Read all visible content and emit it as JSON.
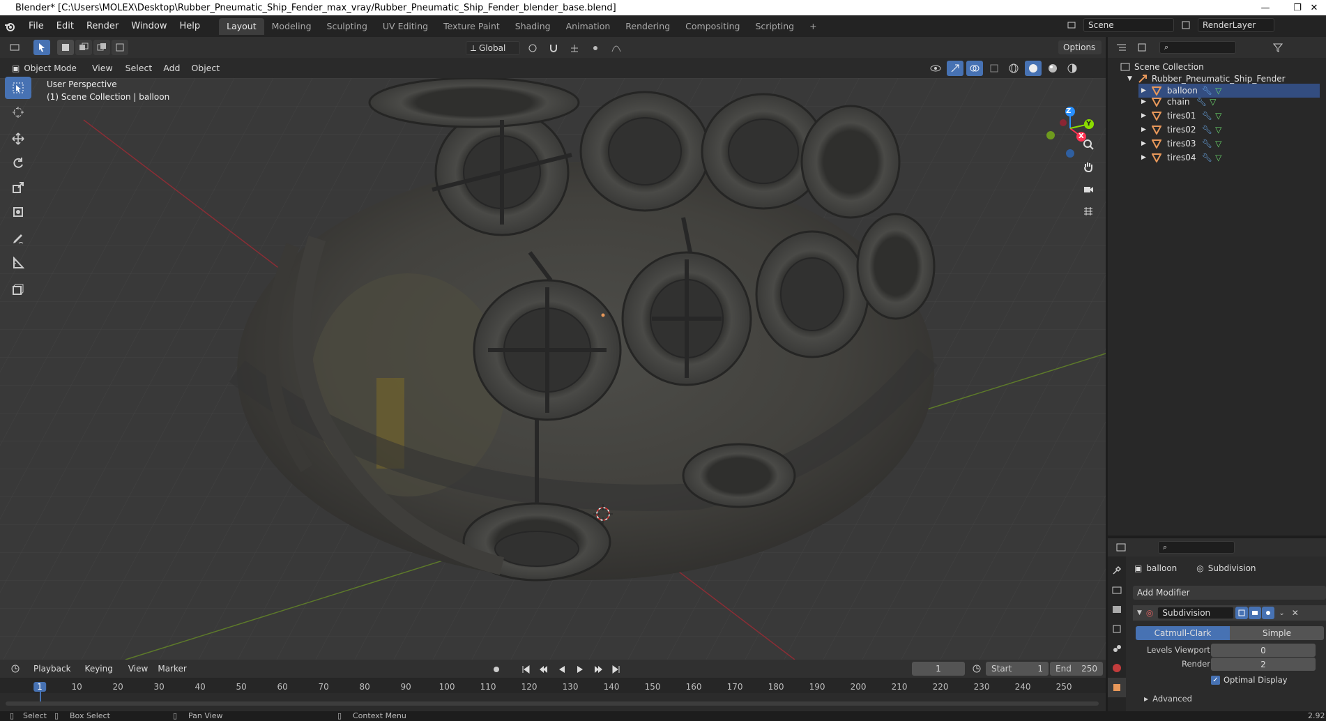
{
  "window": {
    "title": "Blender* [C:\\Users\\MOLEX\\Desktop\\Rubber_Pneumatic_Ship_Fender_max_vray/Rubber_Pneumatic_Ship_Fender_blender_base.blend]",
    "minimize": "—",
    "restore": "❐",
    "close": "✕"
  },
  "menu": [
    "File",
    "Edit",
    "Render",
    "Window",
    "Help"
  ],
  "workspaces": [
    "Layout",
    "Modeling",
    "Sculpting",
    "UV Editing",
    "Texture Paint",
    "Shading",
    "Animation",
    "Rendering",
    "Compositing",
    "Scripting"
  ],
  "add_workspace": "+",
  "scene": {
    "name": "Scene",
    "render_layer": "RenderLayer"
  },
  "viewport_header": {
    "transform_orientation": "Global",
    "options": "Options",
    "mode": "Object Mode",
    "menus": [
      "View",
      "Select",
      "Add",
      "Object"
    ]
  },
  "viewport": {
    "perspective_label": "User Perspective",
    "collection_label": "(1) Scene Collection | balloon",
    "axes": {
      "x": "X",
      "y": "Y",
      "z": "Z"
    }
  },
  "outliner": {
    "root": "Scene Collection",
    "collection": "Rubber_Pneumatic_Ship_Fender",
    "objects": [
      "balloon",
      "chain",
      "tires01",
      "tires02",
      "tires03",
      "tires04"
    ]
  },
  "properties": {
    "object_name": "balloon",
    "modifier_context": "Subdivision",
    "add_modifier": "Add Modifier",
    "modifier_name": "Subdivision",
    "type_options": [
      "Catmull-Clark",
      "Simple"
    ],
    "levels_viewport_label": "Levels Viewport",
    "levels_viewport": "0",
    "render_label": "Render",
    "render_levels": "2",
    "optimal_display": "Optimal Display",
    "advanced": "Advanced"
  },
  "timeline": {
    "menus": [
      "Playback",
      "Keying",
      "View",
      "Marker"
    ],
    "current_frame": "1",
    "start_label": "Start",
    "start": "1",
    "end_label": "End",
    "end": "250",
    "ticks": [
      "1",
      "10",
      "20",
      "30",
      "40",
      "50",
      "60",
      "70",
      "80",
      "90",
      "100",
      "110",
      "120",
      "130",
      "140",
      "150",
      "160",
      "170",
      "180",
      "190",
      "200",
      "210",
      "220",
      "230",
      "240",
      "250"
    ]
  },
  "status": {
    "select": "Select",
    "box_select": "Box Select",
    "pan_view": "Pan View",
    "context_menu": "Context Menu",
    "version": "2.92"
  },
  "colors": {
    "accent": "#4772b3",
    "x_axis": "#ff3352",
    "y_axis": "#8bdc00",
    "z_axis": "#2890ff",
    "object": "#e8985a"
  }
}
